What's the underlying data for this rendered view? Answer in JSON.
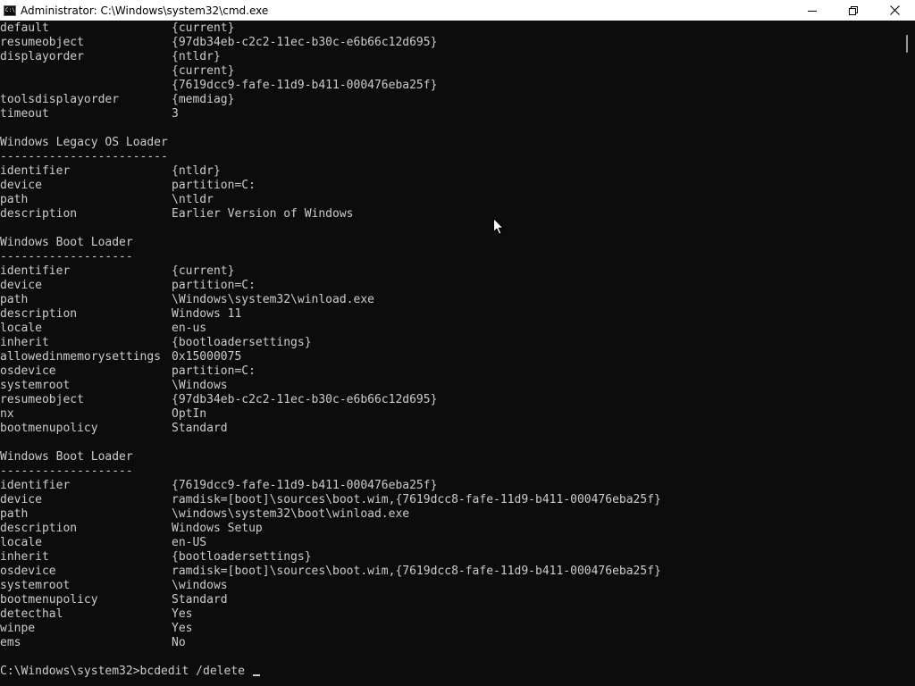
{
  "window": {
    "title": "Administrator: C:\\Windows\\system32\\cmd.exe",
    "icon": "cmd-icon",
    "icon_text": "C:\\"
  },
  "caption_buttons": {
    "minimize": "minimize-icon",
    "maximize": "maximize-icon",
    "close": "close-icon"
  },
  "console": {
    "lines": [
      {
        "key": "default",
        "value": "{current}"
      },
      {
        "key": "resumeobject",
        "value": "{97db34eb-c2c2-11ec-b30c-e6b66c12d695}"
      },
      {
        "key": "displayorder",
        "value": "{ntldr}"
      },
      {
        "key": "",
        "value": "{current}"
      },
      {
        "key": "",
        "value": "{7619dcc9-fafe-11d9-b411-000476eba25f}"
      },
      {
        "key": "toolsdisplayorder",
        "value": "{memdiag}"
      },
      {
        "key": "timeout",
        "value": "3"
      },
      {
        "key": "",
        "value": ""
      },
      {
        "key": "Windows Legacy OS Loader",
        "value": ""
      },
      {
        "key": "------------------------",
        "value": ""
      },
      {
        "key": "identifier",
        "value": "{ntldr}"
      },
      {
        "key": "device",
        "value": "partition=C:"
      },
      {
        "key": "path",
        "value": "\\ntldr"
      },
      {
        "key": "description",
        "value": "Earlier Version of Windows"
      },
      {
        "key": "",
        "value": ""
      },
      {
        "key": "Windows Boot Loader",
        "value": ""
      },
      {
        "key": "-------------------",
        "value": ""
      },
      {
        "key": "identifier",
        "value": "{current}"
      },
      {
        "key": "device",
        "value": "partition=C:"
      },
      {
        "key": "path",
        "value": "\\Windows\\system32\\winload.exe"
      },
      {
        "key": "description",
        "value": "Windows 11"
      },
      {
        "key": "locale",
        "value": "en-us"
      },
      {
        "key": "inherit",
        "value": "{bootloadersettings}"
      },
      {
        "key": "allowedinmemorysettings",
        "value": "0x15000075"
      },
      {
        "key": "osdevice",
        "value": "partition=C:"
      },
      {
        "key": "systemroot",
        "value": "\\Windows"
      },
      {
        "key": "resumeobject",
        "value": "{97db34eb-c2c2-11ec-b30c-e6b66c12d695}"
      },
      {
        "key": "nx",
        "value": "OptIn"
      },
      {
        "key": "bootmenupolicy",
        "value": "Standard"
      },
      {
        "key": "",
        "value": ""
      },
      {
        "key": "Windows Boot Loader",
        "value": ""
      },
      {
        "key": "-------------------",
        "value": ""
      },
      {
        "key": "identifier",
        "value": "{7619dcc9-fafe-11d9-b411-000476eba25f}"
      },
      {
        "key": "device",
        "value": "ramdisk=[boot]\\sources\\boot.wim,{7619dcc8-fafe-11d9-b411-000476eba25f}"
      },
      {
        "key": "path",
        "value": "\\windows\\system32\\boot\\winload.exe"
      },
      {
        "key": "description",
        "value": "Windows Setup"
      },
      {
        "key": "locale",
        "value": "en-US"
      },
      {
        "key": "inherit",
        "value": "{bootloadersettings}"
      },
      {
        "key": "osdevice",
        "value": "ramdisk=[boot]\\sources\\boot.wim,{7619dcc8-fafe-11d9-b411-000476eba25f}"
      },
      {
        "key": "systemroot",
        "value": "\\windows"
      },
      {
        "key": "bootmenupolicy",
        "value": "Standard"
      },
      {
        "key": "detecthal",
        "value": "Yes"
      },
      {
        "key": "winpe",
        "value": "Yes"
      },
      {
        "key": "ems",
        "value": "No"
      },
      {
        "key": "",
        "value": ""
      }
    ],
    "prompt": "C:\\Windows\\system32>",
    "command": "bcdedit /delete "
  },
  "colors": {
    "console_background": "#0c0c0c",
    "console_text": "#cccccc",
    "titlebar": "#ffffff"
  }
}
